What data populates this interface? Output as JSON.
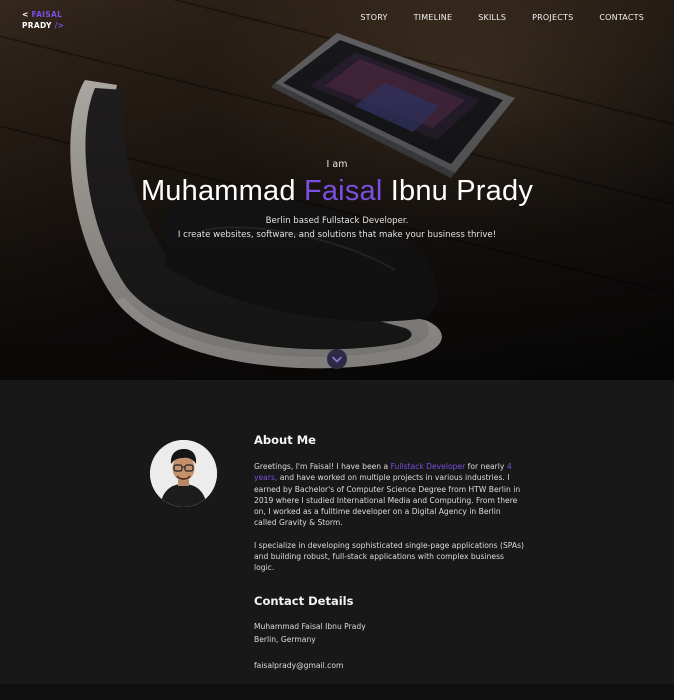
{
  "brand": {
    "line1_prefix": "<",
    "line1_name": "FAISAL",
    "line2_name": "PRADY",
    "line2_suffix": "/>"
  },
  "nav": {
    "items": [
      "STORY",
      "TIMELINE",
      "SKILLS",
      "PROJECTS",
      "CONTACTS"
    ]
  },
  "hero": {
    "intro": "I am",
    "name_first": "Muhammad",
    "name_highlight": "Faisal",
    "name_last": "Ibnu Prady",
    "tagline_line1": "Berlin based Fullstack Developer.",
    "tagline_line2": "I create websites, software, and solutions that make your business thrive!"
  },
  "about": {
    "title": "About Me",
    "p1_a": "Greetings, I'm Faisal! I have been a",
    "p1_role": "Fullstack Developer",
    "p1_b": "for nearly",
    "p1_years": "4 years,",
    "p1_c": "and have worked on multiple projects in various industries. I earned by Bachelor's of Computer Science Degree from HTW Berlin in 2019 where I studied International Media and Computing. From there on, I worked as a fulltime developer on a Digital Agency in Berlin called Gravity & Storm.",
    "p2": "I specialize in developing sophisticated single-page applications (SPAs) and building robust, full-stack applications with complex business logic."
  },
  "contact": {
    "title": "Contact Details",
    "name": "Muhammad Faisal Ibnu Prady",
    "location": "Berlin, Germany",
    "email": "faisalprady@gmail.com"
  },
  "colors": {
    "accent": "#7b4fe0",
    "background": "#181818"
  },
  "icons": {
    "scroll": "chevron-down-icon"
  }
}
